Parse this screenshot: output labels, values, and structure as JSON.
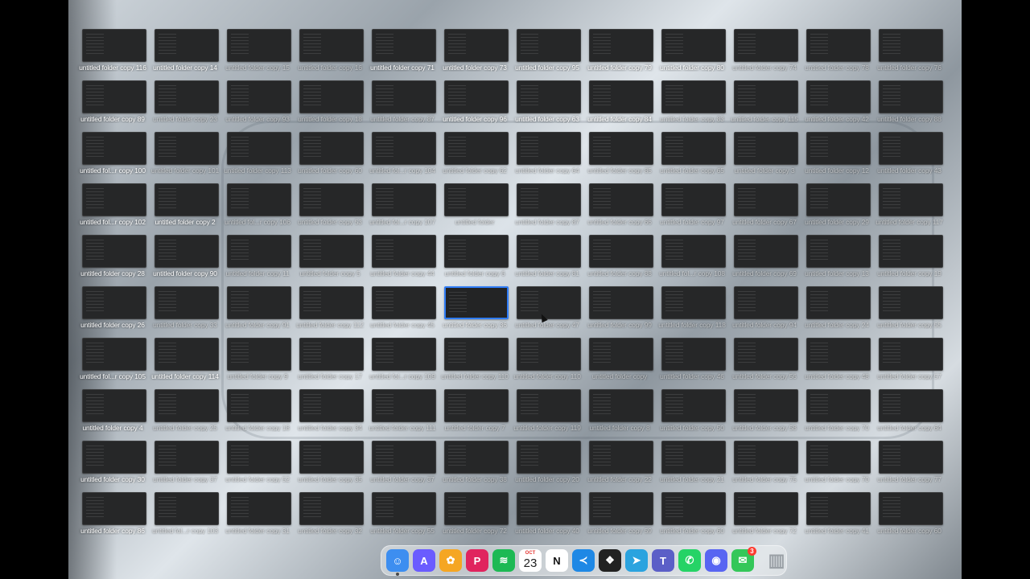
{
  "desktop": {
    "columns": 12,
    "selected_label": "untitled folder copy 36",
    "rows": [
      [
        "untitled folder copy 116",
        "untitled folder copy 14",
        "untitled folder copy 15",
        "untitled folder copy 16",
        "untitled folder copy 71",
        "untitled folder copy 73",
        "untitled folder copy 95",
        "untitled folder copy 79",
        "untitled folder copy 80",
        "untitled folder copy 74",
        "untitled folder copy 78",
        "untitled folder copy 76"
      ],
      [
        "untitled folder copy 89",
        "untitled folder copy 23",
        "untitled folder copy 93",
        "untitled folder copy 18",
        "untitled folder copy 87",
        "untitled folder copy 96",
        "untitled folder copy 63",
        "untitled folder copy 84",
        "untitled folder copy 83",
        "untitled folder copy 115",
        "untitled folder copy 42",
        "untitled folder copy 88"
      ],
      [
        "untitled fol...r copy 100",
        "untitled folder copy 101",
        "untitled folder copy 113",
        "untitled folder copy 60",
        "untitled fol...r copy 104",
        "untitled folder copy 62",
        "untitled folder copy 64",
        "untitled folder copy 85",
        "untitled folder copy 65",
        "untitled folder copy 3",
        "untitled folder copy 12",
        "untitled folder copy 43"
      ],
      [
        "untitled fol...r copy 102",
        "untitled folder copy 2",
        "untitled fol...r copy 106",
        "untitled folder copy 53",
        "untitled fol...r copy 107",
        "untitled folder",
        "untitled folder copy 87",
        "untitled folder copy 66",
        "untitled folder copy 97",
        "untitled folder copy 67",
        "untitled folder copy 29",
        "untitled folder copy 117"
      ],
      [
        "untitled folder copy 28",
        "untitled folder copy 90",
        "untitled folder copy 11",
        "untitled folder copy 5",
        "untitled folder copy 44",
        "untitled folder copy 6",
        "untitled folder copy 81",
        "untitled folder copy 88",
        "untitled fol...r copy 108",
        "untitled folder copy 69",
        "untitled folder copy 13",
        "untitled folder copy 19"
      ],
      [
        "untitled folder copy 26",
        "untitled folder copy 33",
        "untitled folder copy 91",
        "untitled folder copy 112",
        "untitled folder copy 45",
        "untitled folder copy 36",
        "untitled folder copy 47",
        "untitled folder copy 99",
        "untitled folder copy 118",
        "untitled folder copy 94",
        "untitled folder copy 24",
        "untitled folder copy 55"
      ],
      [
        "untitled fol...r copy 105",
        "untitled folder copy 114",
        "untitled folder copy 9",
        "untitled folder copy 17",
        "untitled fol...r copy 109",
        "untitled folder copy 110",
        "untitled folder copy 110",
        "untitled folder copy",
        "untitled folder copy 46",
        "untitled folder copy 56",
        "untitled folder copy 48",
        "untitled folder copy 57"
      ],
      [
        "untitled folder copy 4",
        "untitled folder copy 25",
        "untitled folder copy 18",
        "untitled folder copy 34",
        "untitled folder copy 111",
        "untitled folder copy 7",
        "untitled folder copy 119",
        "untitled folder copy 8",
        "untitled folder copy 50",
        "untitled folder copy 58",
        "untitled folder copy 70",
        "untitled folder copy 64"
      ],
      [
        "untitled folder copy 30",
        "untitled folder copy 37",
        "untitled folder copy 52",
        "untitled folder copy 35",
        "untitled folder copy 37",
        "untitled folder copy 38",
        "untitled folder copy 20",
        "untitled folder copy 22",
        "untitled folder copy 21",
        "untitled folder copy 75",
        "untitled folder copy 70",
        "untitled folder copy 77"
      ],
      [
        "untitled folder copy 86",
        "untitled fol...r copy 103",
        "untitled folder copy 31",
        "untitled folder copy 32",
        "untitled folder copy 55",
        "untitled folder copy 72",
        "untitled folder copy 40",
        "untitled folder copy 59",
        "untitled folder copy 60",
        "untitled folder copy 72",
        "untitled folder copy 41",
        "untitled folder copy 60"
      ]
    ],
    "lit_labels": [
      "untitled folder copy 116",
      "untitled folder copy 14",
      "untitled folder copy 71",
      "untitled folder copy 73",
      "untitled folder copy 95",
      "untitled folder copy 79",
      "untitled folder copy 80",
      "untitled folder copy 89",
      "untitled folder copy 96",
      "untitled folder copy 63",
      "untitled folder copy 84",
      "untitled fol...r copy 100",
      "untitled fol...r copy 102",
      "untitled folder copy 2",
      "untitled folder copy 28",
      "untitled folder copy 90",
      "untitled folder copy 26",
      "untitled fol...r copy 105",
      "untitled folder copy 114",
      "untitled folder copy 4",
      "untitled folder copy 30",
      "untitled folder copy 86"
    ]
  },
  "dock": {
    "apps": [
      {
        "name": "finder-icon",
        "color": "#3d8ef0",
        "glyph": "☺",
        "running": true
      },
      {
        "name": "app-store-icon",
        "color": "#6a5cff",
        "glyph": "A"
      },
      {
        "name": "photos-icon",
        "color": "#f5a623",
        "glyph": "✿"
      },
      {
        "name": "toolbox-icon",
        "color": "#e0245e",
        "glyph": "P"
      },
      {
        "name": "spotify-icon",
        "color": "#1db954",
        "glyph": "≋"
      },
      {
        "name": "calendar-icon",
        "color": "#ffffff",
        "month": "OCT",
        "day": "23"
      },
      {
        "name": "notion-icon",
        "color": "#ffffff",
        "glyph": "N",
        "glyph_color": "#111111"
      },
      {
        "name": "vscode-icon",
        "color": "#1e88e5",
        "glyph": "≺"
      },
      {
        "name": "figma-icon",
        "color": "#222222",
        "glyph": "❖"
      },
      {
        "name": "telegram-icon",
        "color": "#2aa3df",
        "glyph": "➤"
      },
      {
        "name": "teams-icon",
        "color": "#5b5fc7",
        "glyph": "T"
      },
      {
        "name": "whatsapp-icon",
        "color": "#25d366",
        "glyph": "✆"
      },
      {
        "name": "discord-icon",
        "color": "#5865f2",
        "glyph": "◉"
      },
      {
        "name": "messages-icon",
        "color": "#34c759",
        "glyph": "✉",
        "badge": "3"
      }
    ],
    "trash": {
      "name": "trash-icon",
      "color": "#9aa0a6",
      "glyph": "▥"
    }
  }
}
